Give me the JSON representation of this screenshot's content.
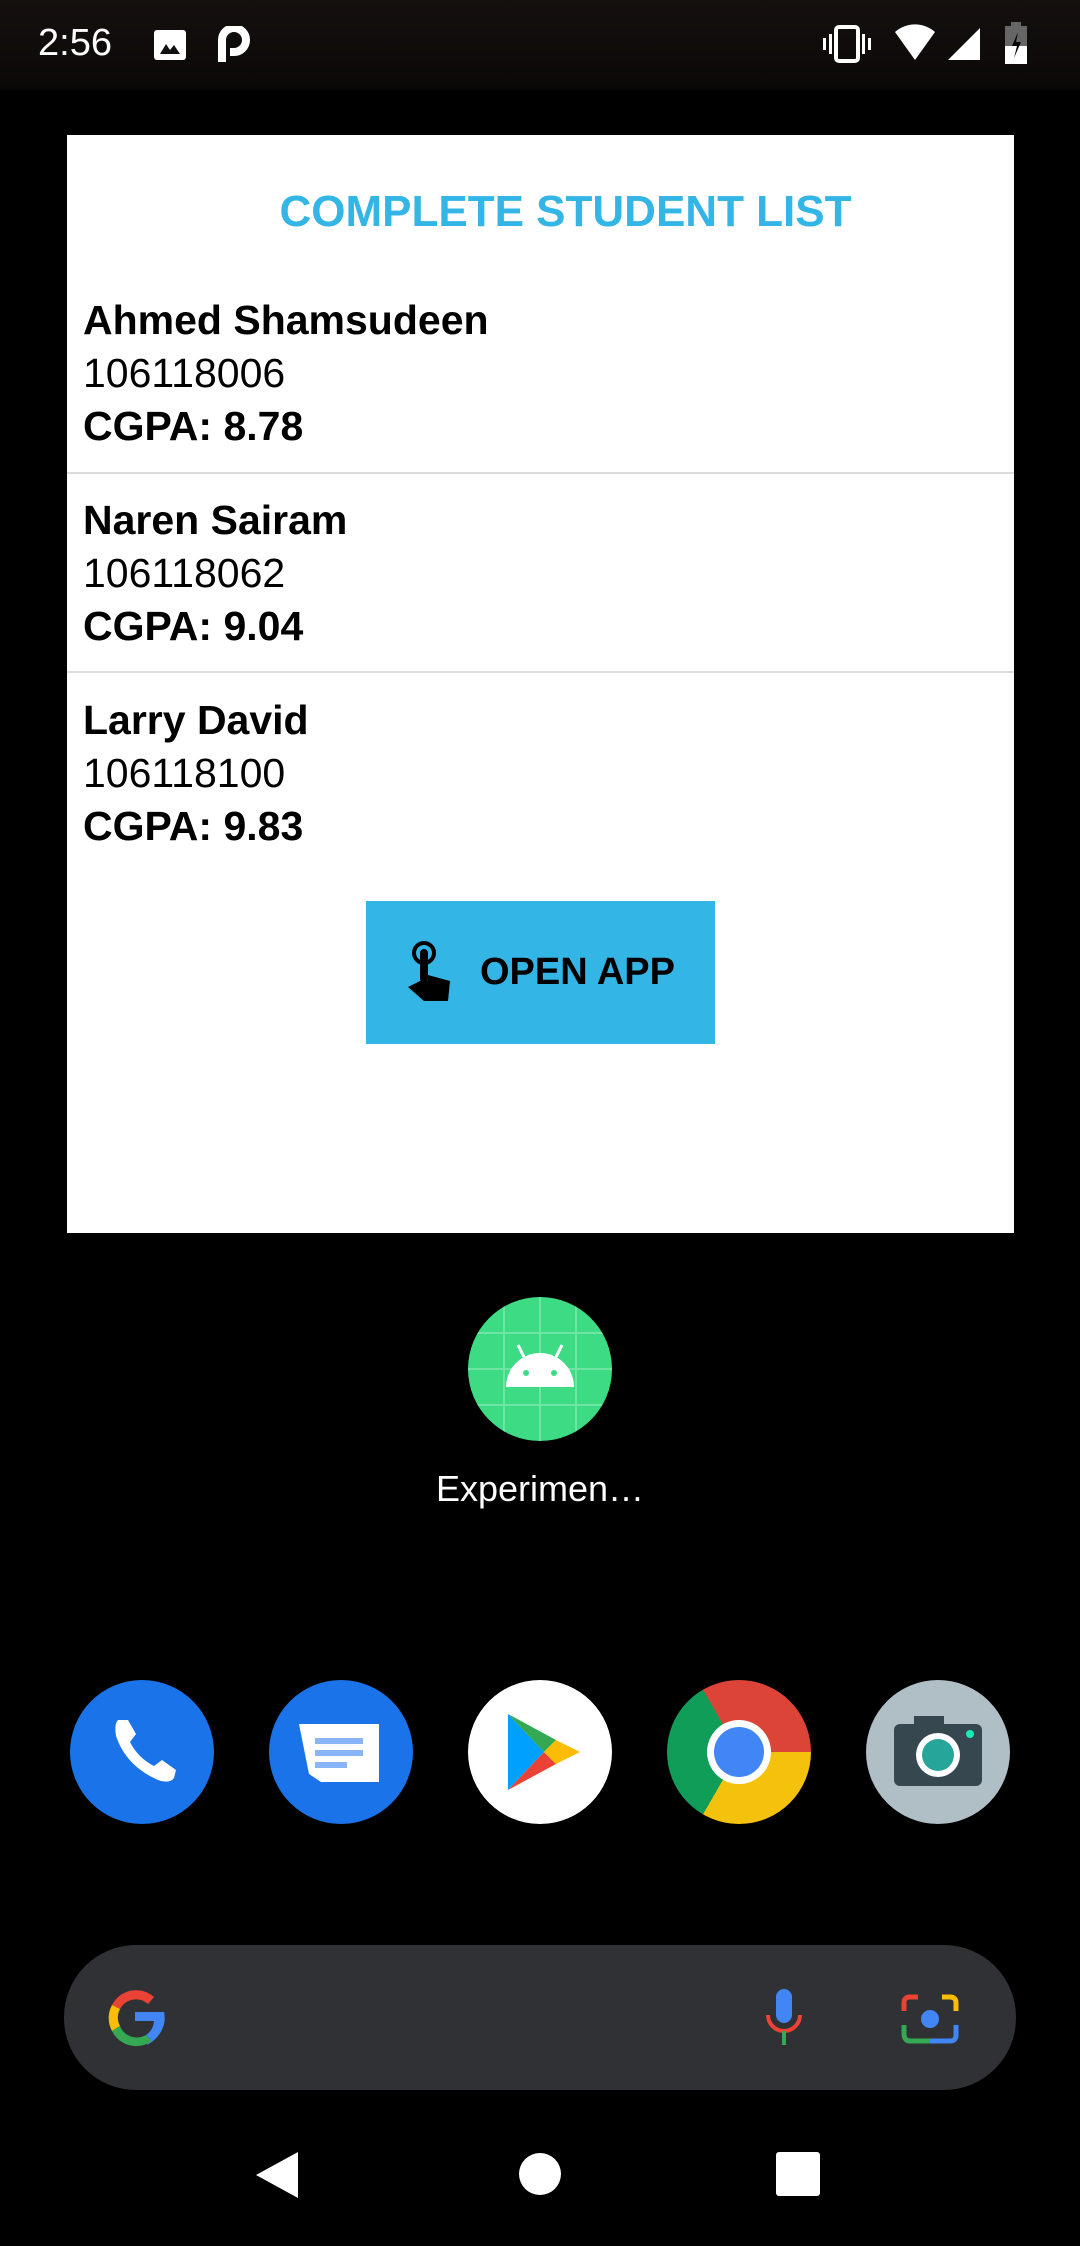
{
  "status_bar": {
    "time": "2:56",
    "left_icons": [
      "image-notification-icon",
      "parking-app-icon"
    ],
    "right_icons": [
      "vibrate-icon",
      "wifi-icon",
      "signal-icon",
      "battery-charging-icon"
    ]
  },
  "widget": {
    "title": "COMPLETE STUDENT LIST",
    "students": [
      {
        "name": "Ahmed Shamsudeen",
        "id": "106118006",
        "cgpa": "CGPA: 8.78"
      },
      {
        "name": "Naren Sairam",
        "id": "106118062",
        "cgpa": "CGPA: 9.04"
      },
      {
        "name": "Larry David",
        "id": "106118100",
        "cgpa": "CGPA: 9.83"
      }
    ],
    "button_label": "OPEN APP",
    "accent": "#33b5e5"
  },
  "home": {
    "app_label": "Experimen…",
    "dock": [
      "phone-icon",
      "messages-icon",
      "play-store-icon",
      "chrome-icon",
      "camera-icon"
    ]
  },
  "search_bar": {
    "icons": [
      "google-icon",
      "mic-icon",
      "lens-icon"
    ]
  },
  "nav": [
    "back-button",
    "home-button",
    "recents-button"
  ]
}
